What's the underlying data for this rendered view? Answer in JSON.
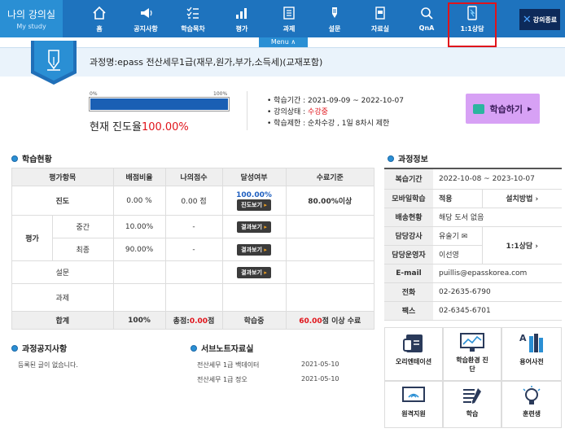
{
  "brand": {
    "title": "나의 강의실",
    "subtitle": "My study"
  },
  "nav": [
    {
      "label": "홈",
      "icon": "home-icon"
    },
    {
      "label": "공지사항",
      "icon": "megaphone-icon"
    },
    {
      "label": "학습목차",
      "icon": "checklist-icon"
    },
    {
      "label": "평가",
      "icon": "bar-chart-icon"
    },
    {
      "label": "과제",
      "icon": "document-icon"
    },
    {
      "label": "설문",
      "icon": "pen-icon"
    },
    {
      "label": "자료실",
      "icon": "folder-icon"
    },
    {
      "label": "QnA",
      "icon": "search-icon"
    },
    {
      "label": "1:1상담",
      "icon": "mobile-consult-icon"
    }
  ],
  "close_button": {
    "label": "강의종료"
  },
  "menu_tab": {
    "label": "Menu ∧"
  },
  "course": {
    "title": "과정명:epass 전산세무1급(재무,원가,부가,소득세)(교재포함)"
  },
  "progress": {
    "min_label": "0%",
    "max_label": "100%",
    "value_percent": 100,
    "text_prefix": "현재 진도율",
    "text_value": "100.00%"
  },
  "study_info": {
    "period": "학습기간 : 2021-09-09 ~ 2022-10-07",
    "status_prefix": "강의상태 : ",
    "status_value": "수강중",
    "limit": "학습제한 : 순차수강 , 1일 8차시 제한"
  },
  "study_button": {
    "label": "학습하기"
  },
  "status_section": {
    "title": "학습현황"
  },
  "status_table": {
    "headers": [
      "평가항목",
      "배점비율",
      "나의점수",
      "달성여부",
      "수료기준"
    ],
    "progress_row": {
      "item": "진도",
      "ratio": "0.00 %",
      "score": "0.00 점",
      "achieve": "100.00%",
      "button": "진도보기",
      "criteria": "80.00%이상"
    },
    "eval_label": "평가",
    "mid_row": {
      "item": "중간",
      "ratio": "10.00%",
      "score": "-",
      "button": "결과보기"
    },
    "final_row": {
      "item": "최종",
      "ratio": "90.00%",
      "score": "-",
      "button": "결과보기"
    },
    "survey_row": {
      "item": "설문",
      "button": "결과보기"
    },
    "assign_row": {
      "item": "과제"
    },
    "total_row": {
      "item": "합계",
      "ratio": "100%",
      "score_prefix": "총점:",
      "score_value": "0.00",
      "score_suffix": "점",
      "achieve": "학습중",
      "criteria_value": "60.00",
      "criteria_suffix": "점 이상 수료"
    }
  },
  "course_info": {
    "title": "과정정보",
    "rows": {
      "review_label": "복습기간",
      "review_value": "2022-10-08 ~ 2023-10-07",
      "mobile_label": "모바일학습",
      "mobile_value": "적용",
      "mobile_method": "설치방법",
      "delivery_label": "배송현황",
      "delivery_value": "해당 도서 없음",
      "instructor_label": "담당강사",
      "instructor_value": "유술기",
      "manager_label": "담당운영자",
      "manager_value": "이선영",
      "consult_label": "1:1상담",
      "email_label": "E-mail",
      "email_value": "puillis@epasskorea.com",
      "phone_label": "전화",
      "phone_value": "02-2635-6790",
      "fax_label": "팩스",
      "fax_value": "02-6345-6701"
    }
  },
  "notice_section": {
    "title": "과정공지사항",
    "empty": "등록된 글이 없습니다."
  },
  "subnote_section": {
    "title": "서브노트자료실",
    "items": [
      {
        "name": "전산세무 1급 백데이터",
        "date": "2021-05-10"
      },
      {
        "name": "전산세무 1급 정오",
        "date": "2021-05-10"
      }
    ]
  },
  "tiles": [
    {
      "label": "오리엔테이션",
      "icon": "orientation-icon"
    },
    {
      "label": "학습환경 진단",
      "icon": "monitor-chart-icon"
    },
    {
      "label": "용어사전",
      "icon": "dictionary-icon"
    },
    {
      "label": "원격지원",
      "icon": "remote-support-icon"
    },
    {
      "label": "학습",
      "icon": "notes-icon"
    },
    {
      "label": "훈련생",
      "icon": "lightbulb-icon"
    }
  ],
  "colors": {
    "nav_bg": "#1e73be",
    "accent_red": "#e0141b",
    "study_button": "#d7a1f5"
  }
}
